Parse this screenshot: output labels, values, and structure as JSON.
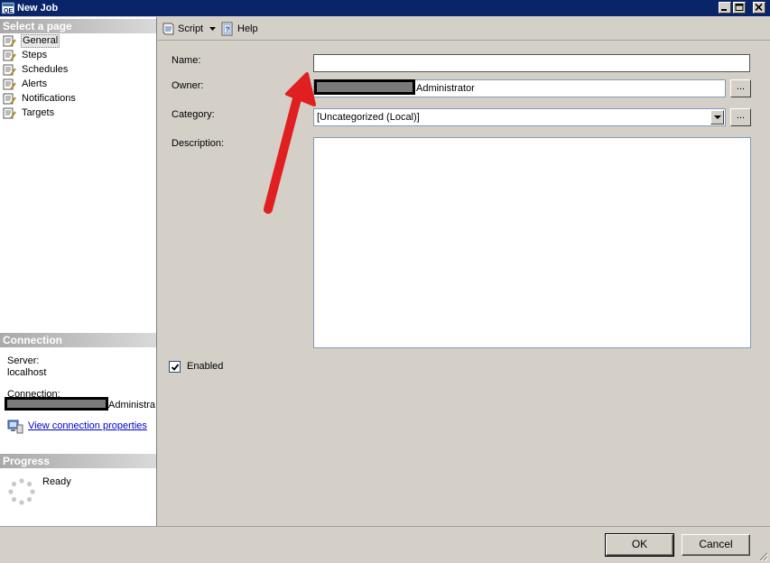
{
  "window": {
    "title": "New Job"
  },
  "sidebar": {
    "select_header": "Select a page",
    "pages": [
      {
        "label": "General",
        "icon": "page-wrench-icon",
        "selected": true
      },
      {
        "label": "Steps",
        "icon": "page-wrench-icon"
      },
      {
        "label": "Schedules",
        "icon": "page-wrench-icon"
      },
      {
        "label": "Alerts",
        "icon": "page-wrench-icon"
      },
      {
        "label": "Notifications",
        "icon": "page-wrench-icon"
      },
      {
        "label": "Targets",
        "icon": "page-wrench-icon"
      }
    ],
    "connection_header": "Connection",
    "server_label": "Server:",
    "server_value": "localhost",
    "connection_label": "Connection:",
    "connection_value_suffix": "Administra",
    "view_connection_link": "View connection properties",
    "progress_header": "Progress",
    "progress_status": "Ready"
  },
  "toolbar": {
    "script_label": "Script",
    "help_label": "Help"
  },
  "form": {
    "name_label": "Name:",
    "name_value": "",
    "owner_label": "Owner:",
    "owner_value_suffix": "Administrator",
    "owner_browse_label": "...",
    "category_label": "Category:",
    "category_value": "[Uncategorized (Local)]",
    "category_browse_label": "...",
    "description_label": "Description:",
    "description_value": "",
    "enabled_label": "Enabled",
    "enabled_checked": true
  },
  "footer": {
    "ok_label": "OK",
    "cancel_label": "Cancel"
  },
  "colors": {
    "title_bar": "#0a246a",
    "annotation_arrow": "#e02020",
    "link": "#0000cc"
  }
}
